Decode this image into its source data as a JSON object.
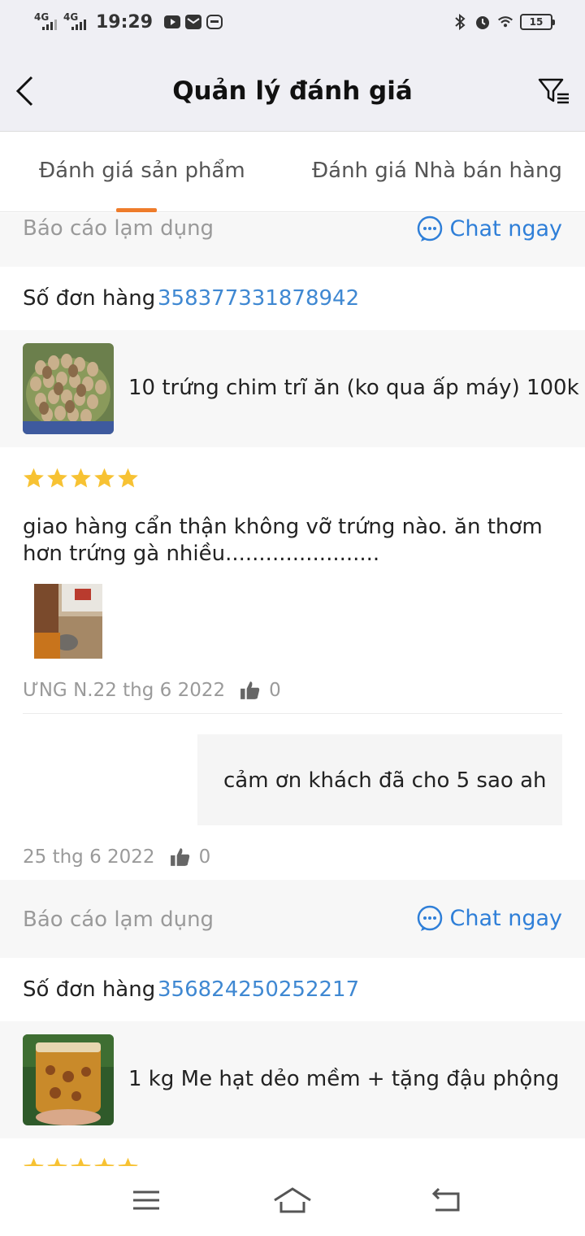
{
  "status_bar": {
    "network_1": "4G",
    "network_2": "4G",
    "time": "19:29",
    "battery": "15"
  },
  "header": {
    "title": "Quản lý đánh giá"
  },
  "tabs": [
    {
      "label": "Đánh giá sản phẩm",
      "active": true
    },
    {
      "label": "Đánh giá Nhà bán hàng",
      "active": false
    }
  ],
  "reviews": [
    {
      "report_label": "Báo cáo lạm dụng",
      "chat_label": "Chat ngay",
      "order_label": "Số đơn hàng",
      "order_number": "358377331878942",
      "product_name": "10 trứng chim trĩ ăn (ko qua ấp máy) 100k",
      "rating": 5,
      "review_text": "giao hàng cẩn thận không vỡ trứng nào. ăn thơm hơn trứng gà nhiều.......................",
      "reviewer_date": "ƯNG N.22 thg 6 2022",
      "review_likes": "0",
      "reply_text": "cảm ơn khách đã cho 5 sao ah",
      "reply_date": "25 thg 6 2022",
      "reply_likes": "0"
    },
    {
      "report_label": "Báo cáo lạm dụng",
      "chat_label": "Chat ngay",
      "order_label": "Số đơn hàng",
      "order_number": "356824250252217",
      "product_name": "1 kg Me hạt dẻo mềm + tặng đậu phộng",
      "rating": 5
    }
  ],
  "colors": {
    "accent_orange": "#ee7c2b",
    "link_blue": "#3f88d2",
    "chat_blue": "#2f7fd8",
    "star_yellow": "#f7c233"
  }
}
